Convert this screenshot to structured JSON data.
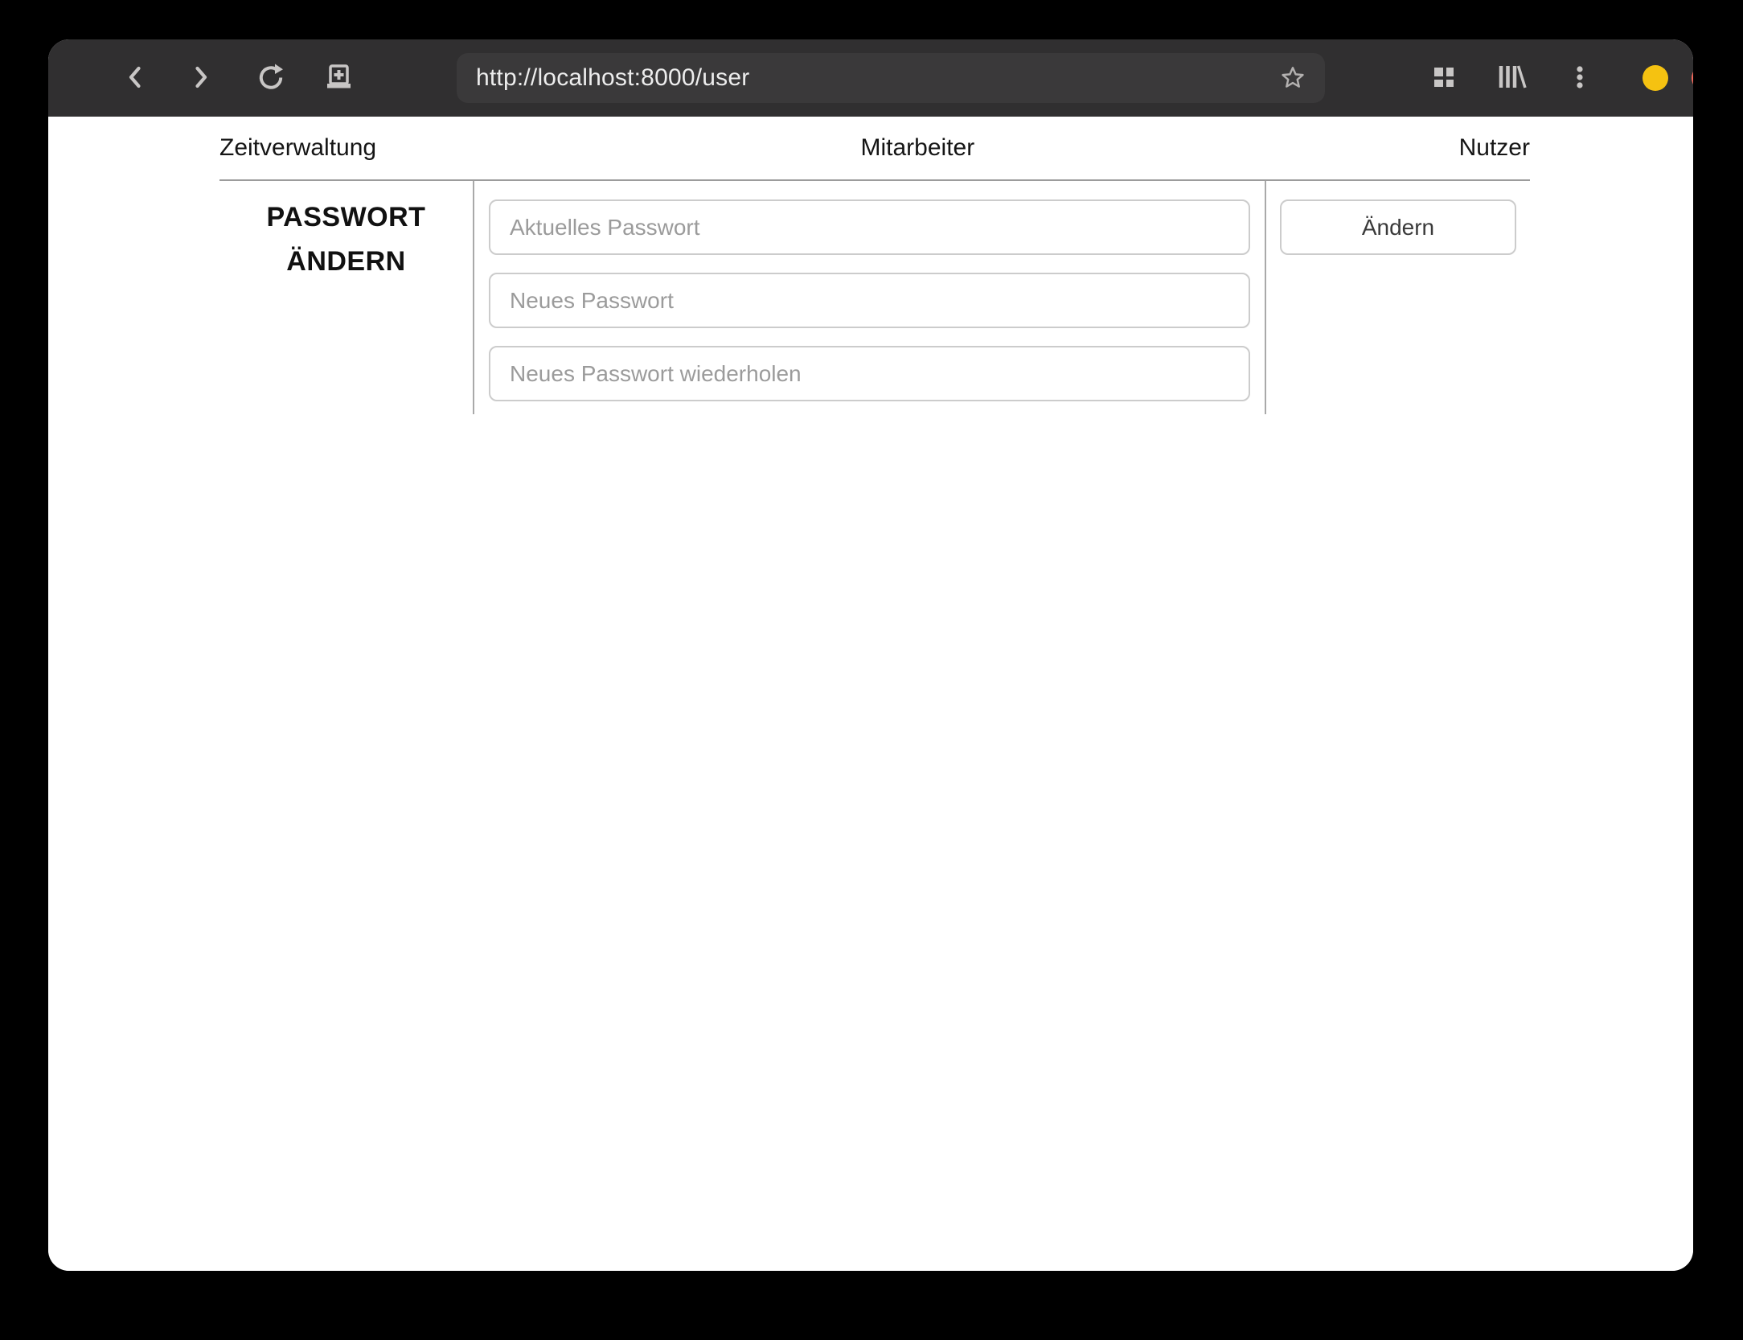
{
  "browser": {
    "url": "http://localhost:8000/user",
    "icons": {
      "back": "chevron-left",
      "forward": "chevron-right",
      "reload": "circular-arrow",
      "new_tab": "tab-with-plus",
      "bookmark": "star-outline",
      "tab_overview": "grid-2x2",
      "library": "books-on-shelf",
      "menu": "kebab-vertical-dots"
    },
    "window_controls": {
      "minimize": "yellow-circle",
      "close": "red-circle"
    }
  },
  "nav": {
    "items": [
      {
        "label": "Zeitverwaltung"
      },
      {
        "label": "Mitarbeiter"
      },
      {
        "label": "Nutzer"
      }
    ]
  },
  "form": {
    "title": "PASSWORT ÄNDERN",
    "fields": [
      {
        "placeholder": "Aktuelles Passwort",
        "value": ""
      },
      {
        "placeholder": "Neues Passwort",
        "value": ""
      },
      {
        "placeholder": "Neues Passwort wiederholen",
        "value": ""
      }
    ],
    "submit_label": "Ändern"
  },
  "colors": {
    "toolbar_bg": "#302f30",
    "urlbar_bg": "#3a393a",
    "icon_gray": "#c8c6c5",
    "minimize_yellow": "#f5c211",
    "close_red": "#f6695c",
    "divider_gray": "#9c9c9c",
    "input_border": "#cccccc",
    "placeholder_gray": "#9b9b9b",
    "page_text": "#151515"
  }
}
